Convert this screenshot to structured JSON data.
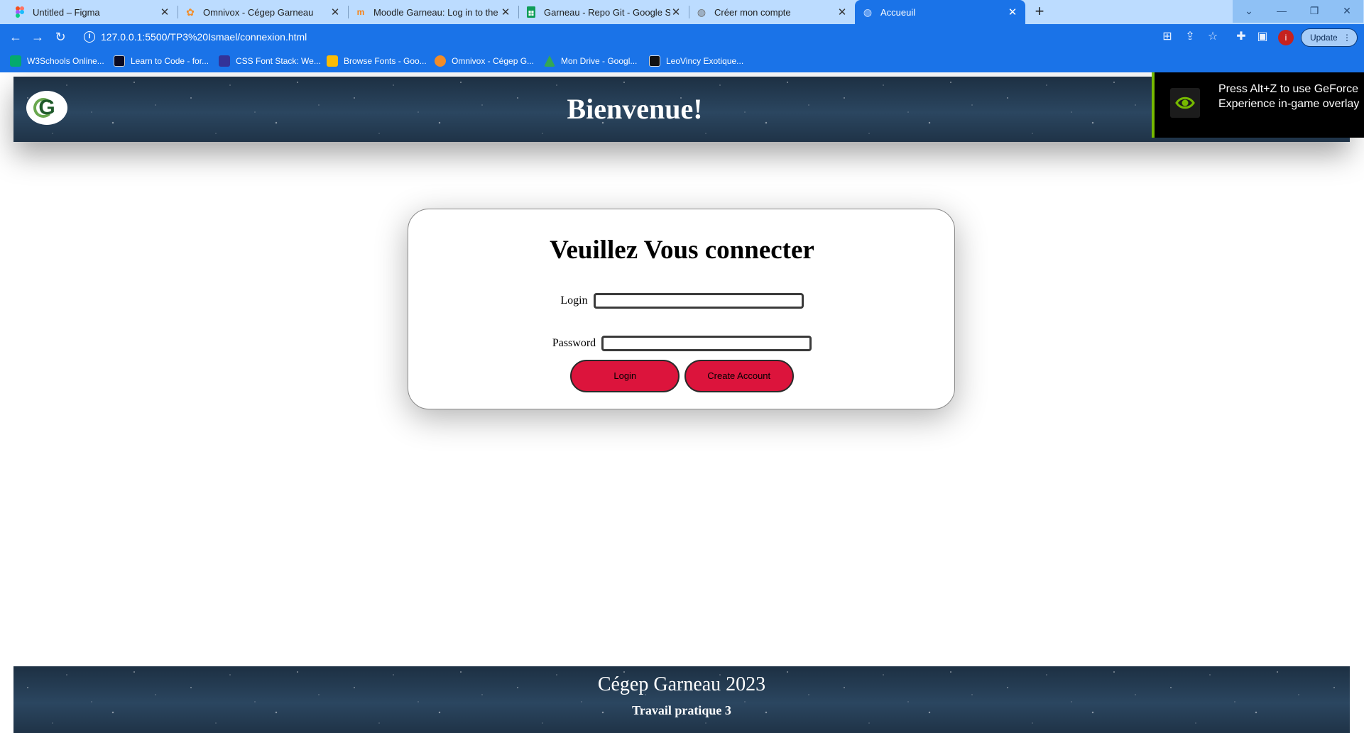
{
  "browser": {
    "tabs": [
      {
        "title": "Untitled – Figma",
        "icon": "figma-icon",
        "active": false
      },
      {
        "title": "Omnivox - Cégep Garneau",
        "icon": "omnivox-icon",
        "active": false
      },
      {
        "title": "Moodle Garneau: Log in to the si",
        "icon": "moodle-icon",
        "active": false
      },
      {
        "title": "Garneau - Repo Git - Google She",
        "icon": "sheets-icon",
        "active": false
      },
      {
        "title": "Créer mon compte",
        "icon": "globe-icon",
        "active": false
      },
      {
        "title": "Accueuil",
        "icon": "globe-icon",
        "active": true
      }
    ],
    "url": "127.0.0.1:5500/TP3%20Ismael/connexion.html",
    "update_label": "Update",
    "profile_initial": "i",
    "bookmarks": [
      {
        "label": "W3Schools Online...",
        "icon": "w3schools-icon",
        "color": "#04aa6d"
      },
      {
        "label": "Learn to Code - for...",
        "icon": "freecodecamp-icon",
        "color": "#0a0a23"
      },
      {
        "label": "CSS Font Stack: We...",
        "icon": "cssfontstack-icon",
        "color": "#333399"
      },
      {
        "label": "Browse Fonts - Goo...",
        "icon": "google-fonts-icon",
        "color": "#fbbc04"
      },
      {
        "label": "Omnivox - Cégep G...",
        "icon": "omnivox-icon",
        "color": "#f28c28"
      },
      {
        "label": "Mon Drive - Googl...",
        "icon": "google-drive-icon",
        "color": "#34a853"
      },
      {
        "label": "LeoVincy Exotique...",
        "icon": "leovincy-icon",
        "color": "#111111"
      }
    ]
  },
  "overlay": {
    "text": "Press Alt+Z to use GeForce Experience in-game overlay",
    "accent_color": "#76b900"
  },
  "header": {
    "title": "Bienvenue!",
    "logo_letter": "G"
  },
  "login": {
    "heading": "Veuillez Vous connecter",
    "login_label": "Login",
    "login_value": "",
    "password_label": "Password",
    "password_value": "",
    "login_button": "Login",
    "create_button": "Create Account",
    "button_color": "#dc143c"
  },
  "footer": {
    "title": "Cégep Garneau 2023",
    "subtitle": "Travail pratique 3"
  }
}
